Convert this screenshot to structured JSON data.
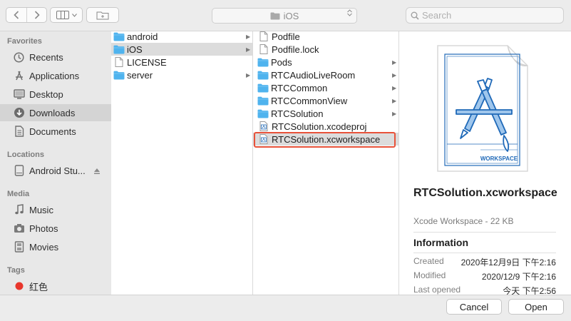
{
  "toolbar": {
    "back_icon": "chevron-left-icon",
    "forward_icon": "chevron-right-icon",
    "view_icon": "column-view-icon",
    "new_folder_icon": "new-folder-icon",
    "path": "iOS",
    "search_placeholder": "Search"
  },
  "sidebar": {
    "favorites": "Favorites",
    "favorites_items": [
      {
        "label": "Recents",
        "icon": "clock-icon"
      },
      {
        "label": "Applications",
        "icon": "applications-icon"
      },
      {
        "label": "Desktop",
        "icon": "desktop-icon"
      },
      {
        "label": "Downloads",
        "icon": "downloads-icon",
        "selected": true
      },
      {
        "label": "Documents",
        "icon": "documents-icon"
      }
    ],
    "locations": "Locations",
    "locations_items": [
      {
        "label": "Android Stu...",
        "icon": "disk-icon"
      }
    ],
    "media": "Media",
    "media_items": [
      {
        "label": "Music",
        "icon": "music-icon"
      },
      {
        "label": "Photos",
        "icon": "camera-icon"
      },
      {
        "label": "Movies",
        "icon": "film-icon"
      }
    ],
    "tags": "Tags",
    "tags_items": [
      {
        "label": "红色",
        "color": "#e8362c"
      }
    ]
  },
  "col1": [
    {
      "label": "android",
      "type": "folder",
      "arrow": true
    },
    {
      "label": "iOS",
      "type": "folder",
      "arrow": true,
      "selected": true
    },
    {
      "label": "LICENSE",
      "type": "file"
    },
    {
      "label": "server",
      "type": "folder",
      "arrow": true
    }
  ],
  "col2": [
    {
      "label": "Podfile",
      "type": "file"
    },
    {
      "label": "Podfile.lock",
      "type": "file"
    },
    {
      "label": "Pods",
      "type": "folder",
      "arrow": true
    },
    {
      "label": "RTCAudioLiveRoom",
      "type": "folder",
      "arrow": true
    },
    {
      "label": "RTCCommon",
      "type": "folder",
      "arrow": true
    },
    {
      "label": "RTCCommonView",
      "type": "folder",
      "arrow": true
    },
    {
      "label": "RTCSolution",
      "type": "folder",
      "arrow": true
    },
    {
      "label": "RTCSolution.xcodeproj",
      "type": "xcode"
    },
    {
      "label": "RTCSolution.xcworkspace",
      "type": "xcode",
      "selected": true
    }
  ],
  "preview": {
    "badge": "WORKSPACE",
    "name": "RTCSolution.xcworkspace",
    "kind": "Xcode Workspace - 22 KB",
    "info_title": "Information",
    "meta": [
      {
        "key": "Created",
        "value": "2020年12月9日 下午2:16"
      },
      {
        "key": "Modified",
        "value": "2020/12/9 下午2:16"
      },
      {
        "key": "Last opened",
        "value": "今天 下午2:56"
      }
    ]
  },
  "buttons": {
    "cancel": "Cancel",
    "open": "Open"
  },
  "colors": {
    "folder": "#4fb3ee",
    "selection_ring": "#e8523a",
    "blueprint": "#1f69b8"
  }
}
